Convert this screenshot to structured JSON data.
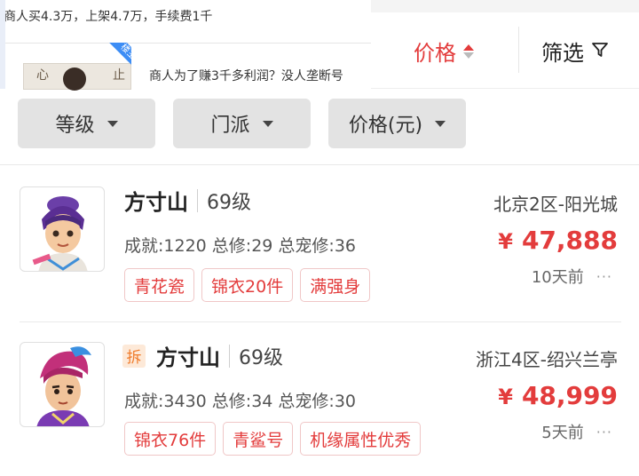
{
  "popup": {
    "line1": "商人买4.3万，上架4.7万，手续费1千",
    "title2": "商人为了赚3千多利润？没人垄断号",
    "ribbon": "楼主",
    "thumb_chars": [
      "心",
      "止"
    ]
  },
  "sort": {
    "price_label": "价格",
    "filter_label": "筛选"
  },
  "filters": [
    {
      "label": "等级"
    },
    {
      "label": "门派"
    },
    {
      "label": "价格(元)"
    }
  ],
  "listings": [
    {
      "prefix_badge": "",
      "name": "方寸山",
      "level": "69级",
      "stats": "成就:1220 总修:29 总宠修:36",
      "tags": [
        "青花瓷",
        "锦衣20件",
        "满强身"
      ],
      "server": "北京2区-阳光城",
      "currency": "¥",
      "price": "47,888",
      "time": "10天前",
      "more": "···"
    },
    {
      "prefix_badge": "拆",
      "name": "方寸山",
      "level": "69级",
      "stats": "成就:3430 总修:34 总宠修:30",
      "tags": [
        "锦衣76件",
        "青鲨号",
        "机缘属性优秀"
      ],
      "server": "浙江4区-绍兴兰亭",
      "currency": "¥",
      "price": "48,999",
      "time": "5天前",
      "more": "···"
    }
  ],
  "colors": {
    "accent": "#e33c3c",
    "pill_bg": "#e3e3e3",
    "badge_orange": "#f07b2b"
  },
  "icons": [
    "sort-arrows-icon",
    "filter-funnel-icon",
    "caret-down-icon",
    "more-dots-icon"
  ]
}
